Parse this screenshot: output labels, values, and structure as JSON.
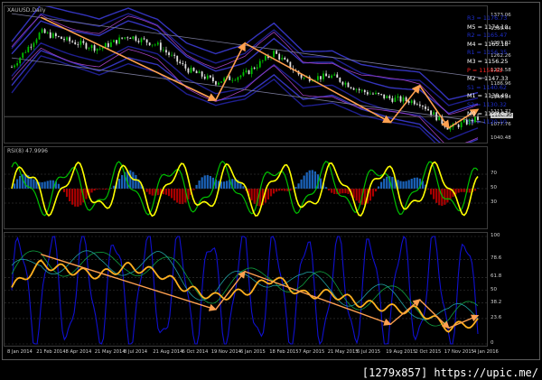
{
  "main": {
    "title": "XAUUSD,Daily",
    "price_ticks": [
      "1373.06",
      "1335.44",
      "1297.82",
      "1262.26",
      "1224.58",
      "1186.96",
      "1149.34",
      "1111.72",
      "1077.76",
      "1040.48"
    ],
    "current_price": "1100.90",
    "pivots": [
      {
        "label": "R3 = 1176.73",
        "color": "#1e2ecb"
      },
      {
        "label": "M5 = 1174.10",
        "color": "#ffffff"
      },
      {
        "label": "R2 = 1165.47",
        "color": "#1e2ecb"
      },
      {
        "label": "M4 = 1165.18",
        "color": "#ffffff"
      },
      {
        "label": "R1 = 1156.35",
        "color": "#1e2ecb"
      },
      {
        "label": "M3 = 1156.25",
        "color": "#ffffff"
      },
      {
        "label": "P = 1150.62",
        "color": "#ff2020"
      },
      {
        "label": "M2 = 1147.33",
        "color": "#ffffff"
      },
      {
        "label": "S1 = 1140.62",
        "color": "#1e2ecb"
      },
      {
        "label": "M1 = 1138.40",
        "color": "#ffffff"
      },
      {
        "label": "S2 = 1130.32",
        "color": "#1e2ecb"
      },
      {
        "label": "M0 = 1129.47",
        "color": "#ffffff"
      },
      {
        "label": "S3 = 1120.10",
        "color": "#1e2ecb"
      }
    ]
  },
  "rsi": {
    "title": "RSI(8) 47.9996",
    "ticks": [
      "70",
      "50",
      "30"
    ]
  },
  "stoch": {
    "ticks": [
      "100",
      "78.6",
      "61.8",
      "50",
      "38.2",
      "23.6",
      "0"
    ]
  },
  "time_labels": [
    "8 Jan 2014",
    "21 Feb 2014",
    "8 Apr 2014",
    "21 May 2014",
    "8 Jul 2014",
    "21 Aug 2014",
    "6 Oct 2014",
    "19 Nov 2014",
    "6 Jan 2015",
    "18 Feb 2015",
    "7 Apr 2015",
    "21 May 2015",
    "6 Jul 2015",
    "19 Aug 2015",
    "2 Oct 2015",
    "17 Nov 2015",
    "4 Jan 2016"
  ],
  "watermark": "[1279x857] https://upic.me/",
  "colors": {
    "arrow": "#ffa050",
    "bull_candle": "#00c000",
    "bear_candle": "#e0e0e0",
    "channel": "#1a2aa8",
    "rsi_line": "#ffff00",
    "rsi_signal": "#00c000",
    "rsi_histo_up": "#1e6fd0",
    "rsi_histo_down": "#c00000",
    "stoch_main": "#ffb020",
    "stoch_signal": "#1010d0"
  },
  "chart_data": {
    "type": "line",
    "title": "XAUUSD,Daily",
    "xlabel": "",
    "ylabel": "",
    "ylim": [
      1040,
      1390
    ],
    "categories": [
      "8 Jan 2014",
      "21 Feb 2014",
      "8 Apr 2014",
      "21 May 2014",
      "8 Jul 2014",
      "21 Aug 2014",
      "6 Oct 2014",
      "19 Nov 2014",
      "6 Jan 2015",
      "18 Feb 2015",
      "7 Apr 2015",
      "21 May 2015",
      "6 Jul 2015",
      "19 Aug 2015",
      "2 Oct 2015",
      "17 Nov 2015",
      "4 Jan 2016"
    ],
    "series": [
      {
        "values": [
          1235,
          1330,
          1305,
          1285,
          1320,
          1295,
          1230,
          1195,
          1215,
          1275,
          1205,
          1210,
          1170,
          1150,
          1140,
          1070,
          1095
        ]
      }
    ],
    "trend_arrows": [
      {
        "from": [
          "21 Feb 2014",
          1370
        ],
        "to": [
          "19 Nov 2014",
          1145
        ]
      },
      {
        "from": [
          "19 Nov 2014",
          1145
        ],
        "to": [
          "6 Jan 2015",
          1300
        ]
      },
      {
        "from": [
          "6 Jan 2015",
          1300
        ],
        "to": [
          "19 Aug 2015",
          1085
        ]
      },
      {
        "from": [
          "19 Aug 2015",
          1085
        ],
        "to": [
          "2 Oct 2015",
          1185
        ]
      },
      {
        "from": [
          "2 Oct 2015",
          1185
        ],
        "to": [
          "17 Nov 2015",
          1070
        ]
      },
      {
        "from": [
          "17 Nov 2015",
          1070
        ],
        "to": [
          "4 Jan 2016",
          1120
        ]
      }
    ],
    "legend": "none",
    "grid": false
  }
}
